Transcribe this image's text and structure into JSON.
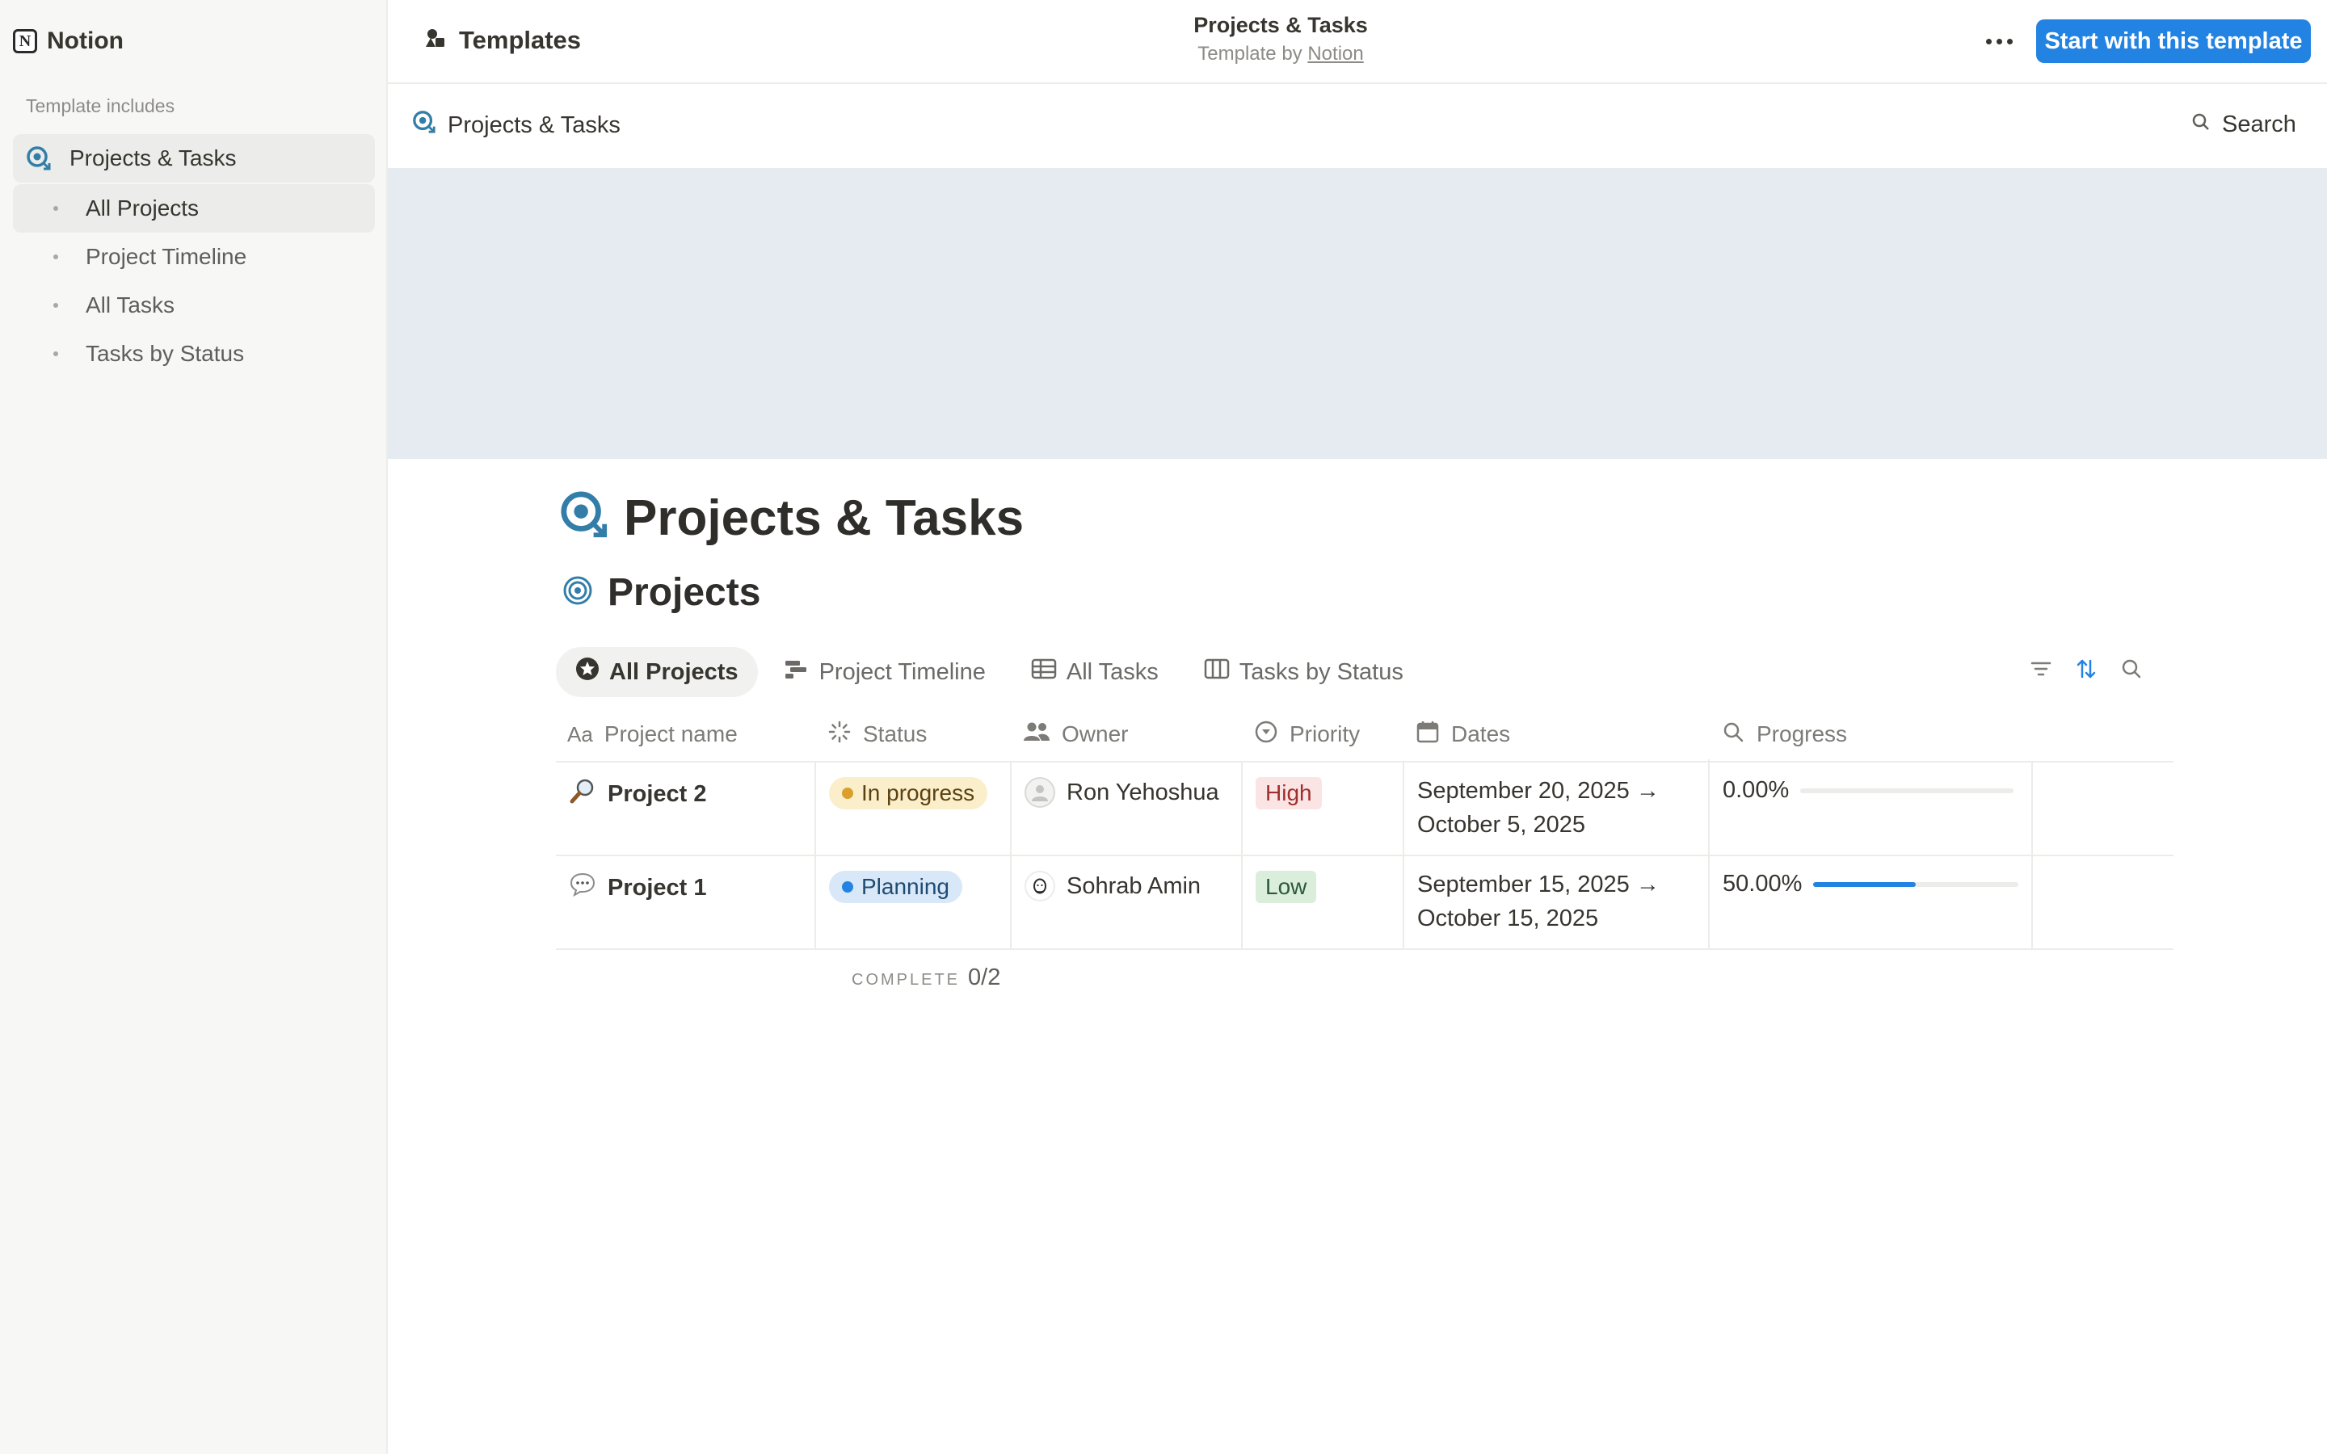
{
  "sidebar": {
    "brand": "Notion",
    "includes_label": "Template includes",
    "items": [
      {
        "label": "Projects & Tasks"
      },
      {
        "label": "All Projects"
      },
      {
        "label": "Project Timeline"
      },
      {
        "label": "All Tasks"
      },
      {
        "label": "Tasks by Status"
      }
    ]
  },
  "topbar": {
    "templates_label": "Templates",
    "title": "Projects & Tasks",
    "subtitle_prefix": "Template by",
    "subtitle_link": "Notion",
    "start_button": "Start with this template"
  },
  "subheader": {
    "breadcrumb": "Projects & Tasks",
    "search_label": "Search"
  },
  "page": {
    "title": "Projects & Tasks",
    "database_title": "Projects"
  },
  "views": [
    {
      "label": "All Projects",
      "icon": "star-circle-icon"
    },
    {
      "label": "Project Timeline",
      "icon": "timeline-icon"
    },
    {
      "label": "All Tasks",
      "icon": "table-icon"
    },
    {
      "label": "Tasks by Status",
      "icon": "board-icon"
    }
  ],
  "table": {
    "columns": [
      "Project name",
      "Status",
      "Owner",
      "Priority",
      "Dates",
      "Progress"
    ],
    "rows": [
      {
        "name": "Project 2",
        "icon": "magnifier-icon",
        "status": "In progress",
        "owner": "Ron Yehoshua",
        "priority": "High",
        "dates_line1": "September 20, 2025 →",
        "dates_line2": "October 5, 2025",
        "progress_label": "0.00%",
        "progress": 0.0
      },
      {
        "name": "Project 1",
        "icon": "speech-bubble-icon",
        "status": "Planning",
        "owner": "Sohrab Amin",
        "priority": "Low",
        "dates_line1": "September 15, 2025 →",
        "dates_line2": "October 15, 2025",
        "progress_label": "50.00%",
        "progress": 0.5
      }
    ],
    "footer_key": "COMPLETE",
    "footer_value": "0/2"
  },
  "colors": {
    "accent": "#2383e2",
    "cover": "#e5ebf1",
    "in_progress_bg": "#fbeecb",
    "in_progress_dot": "#d9a12b",
    "planning_bg": "#d8e8f8",
    "planning_dot": "#2383e2",
    "high_bg": "#fbe4e4",
    "high_text": "#9f2f2d",
    "low_bg": "#dbeddb",
    "low_text": "#2b593f"
  }
}
